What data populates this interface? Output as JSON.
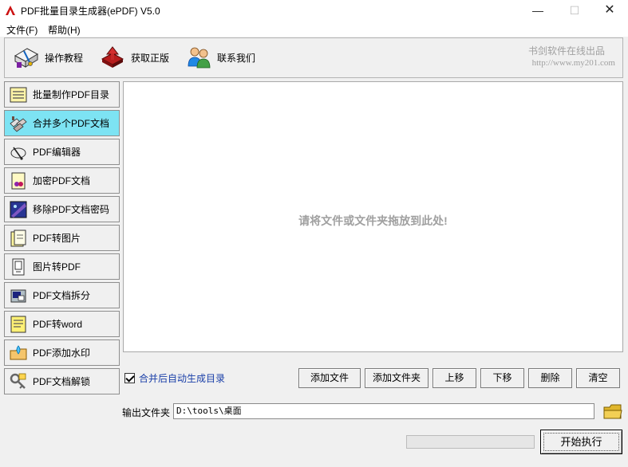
{
  "window": {
    "title": "PDF批量目录生成器(ePDF) V5.0",
    "controls": {
      "minimize": "—",
      "maximize": "☐",
      "close": "✕"
    }
  },
  "menu": {
    "file": "文件(F)",
    "help": "帮助(H)"
  },
  "toolbar": {
    "items": [
      {
        "label": "操作教程",
        "icon": "tutorial-icon"
      },
      {
        "label": "获取正版",
        "icon": "genuine-icon"
      },
      {
        "label": "联系我们",
        "icon": "contact-icon"
      }
    ],
    "vendor_name": "书剑软件在线出品",
    "vendor_url": "http://www.my201.com"
  },
  "sidebar": {
    "items": [
      {
        "label": "批量制作PDF目录",
        "icon": "toc-icon",
        "active": false
      },
      {
        "label": "合并多个PDF文档",
        "icon": "merge-icon",
        "active": true
      },
      {
        "label": "PDF编辑器",
        "icon": "editor-icon",
        "active": false
      },
      {
        "label": "加密PDF文档",
        "icon": "encrypt-icon",
        "active": false
      },
      {
        "label": "移除PDF文档密码",
        "icon": "remove-password-icon",
        "active": false
      },
      {
        "label": "PDF转图片",
        "icon": "pdf-to-image-icon",
        "active": false
      },
      {
        "label": "图片转PDF",
        "icon": "image-to-pdf-icon",
        "active": false
      },
      {
        "label": "PDF文档拆分",
        "icon": "split-icon",
        "active": false
      },
      {
        "label": "PDF转word",
        "icon": "pdf-to-word-icon",
        "active": false
      },
      {
        "label": "PDF添加水印",
        "icon": "watermark-icon",
        "active": false
      },
      {
        "label": "PDF文档解锁",
        "icon": "unlock-icon",
        "active": false
      }
    ]
  },
  "drop_area": {
    "hint": "请将文件或文件夹拖放到此处!"
  },
  "options": {
    "auto_toc_label": "合并后自动生成目录",
    "auto_toc_checked": true
  },
  "actions": {
    "add_file": "添加文件",
    "add_folder": "添加文件夹",
    "move_up": "上移",
    "move_down": "下移",
    "delete": "删除",
    "clear": "清空"
  },
  "output": {
    "label": "输出文件夹",
    "path": "D:\\tools\\桌面"
  },
  "progress": {
    "value": 0
  },
  "start_button": "开始执行",
  "colors": {
    "active_item": "#7de3f3",
    "checkbox_label": "#1a3fa8",
    "drop_hint": "#a0a0a0",
    "brand_red": "#cc1111"
  }
}
